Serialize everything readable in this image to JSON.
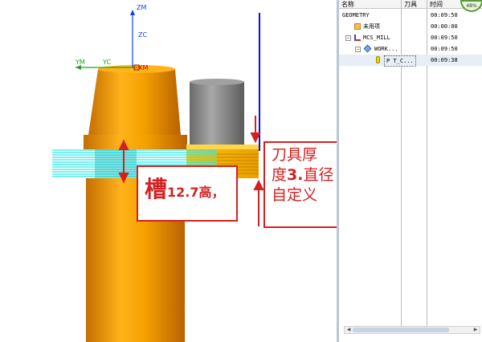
{
  "viewport": {
    "axis_labels": {
      "zm": "ZM",
      "zc": "ZC",
      "ym": "YM",
      "yc": "YC",
      "xm": "XM"
    },
    "callout_slot": {
      "char": "槽",
      "rest": "12.7高，"
    },
    "callout_tool": {
      "line1": "刀具厚",
      "line2_prefix": "度",
      "line2_bold": "3.",
      "line2_suffix": "直径",
      "line3": "自定义"
    },
    "colors": {
      "part_orange": "#f5a000",
      "hatch_cyan": "#2ee6e6",
      "callout_red": "#d42020",
      "tool_gray": "#8a8a8a",
      "axis_blue": "#1010e0"
    }
  },
  "navigator": {
    "columns": {
      "name": "名称",
      "tool": "刀具",
      "time": "时间"
    },
    "progress_badge": "48%",
    "rows": [
      {
        "name": "GEOMETRY",
        "time": "00:09:50"
      },
      {
        "name": "未用项",
        "time": "00:00:00",
        "icon": "folder-icon"
      },
      {
        "name": "MCS_MILL",
        "time": "00:09:50",
        "icon": "mcs-icon",
        "expander": "−"
      },
      {
        "name": "WORK...",
        "time": "00:09:50",
        "icon": "workpiece-icon",
        "expander": "−"
      },
      {
        "name": "T_C...",
        "time": "00:09:38",
        "icon": "operation-icon",
        "prefix": "P"
      }
    ]
  }
}
